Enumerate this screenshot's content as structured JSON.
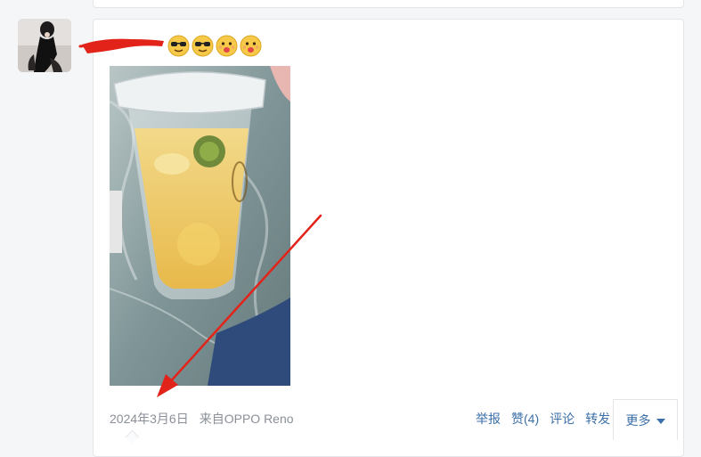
{
  "post": {
    "date": "2024年3月6日",
    "source": "来自OPPO Reno",
    "emojis": [
      "sunglasses-emoji",
      "sunglasses-emoji",
      "tongue-emoji",
      "tongue-emoji"
    ]
  },
  "actions": {
    "report": "举报",
    "like": "赞(4)",
    "comment": "评论",
    "share": "转发",
    "more": "更多"
  },
  "colors": {
    "link": "#3b6fa8",
    "meta_text": "#8a8f98",
    "annotation_red": "#e2231a",
    "card_border": "#e3e5e8"
  }
}
